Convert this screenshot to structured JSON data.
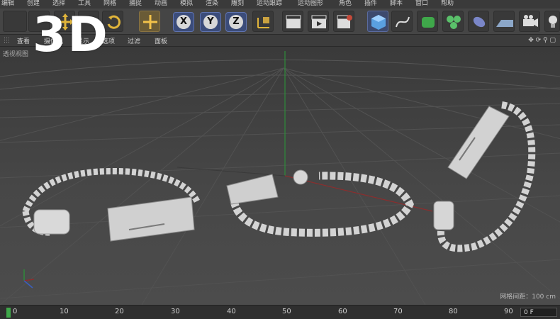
{
  "menu": [
    "编辑",
    "创建",
    "选择",
    "工具",
    "网格",
    "捕捉",
    "动画",
    "模拟",
    "渲染",
    "雕刻",
    "运动跟踪",
    "运动图形",
    "角色",
    "插件",
    "脚本",
    "窗口",
    "帮助"
  ],
  "toolbar": {
    "axis_labels": [
      "X",
      "Y",
      "Z"
    ]
  },
  "viewport_menu": [
    "查看",
    "摄像机",
    "显示",
    "选项",
    "过滤",
    "面板"
  ],
  "viewport": {
    "title": "透视视图",
    "grid_info": "网格间距：100 cm"
  },
  "timeline": {
    "ticks": [
      "0",
      "10",
      "20",
      "30",
      "40",
      "50",
      "60",
      "70",
      "80",
      "90"
    ],
    "frame_value": "0 F"
  },
  "badge": "3D",
  "colors": {
    "menubar": "#3a3a3a",
    "toolbar": "#454545",
    "viewport": "#474747",
    "axis_y": "#2e8b3a",
    "axis_x": "#8b2e2e",
    "playhead": "#3fa84a",
    "jewelry": "#cfcfcf"
  }
}
